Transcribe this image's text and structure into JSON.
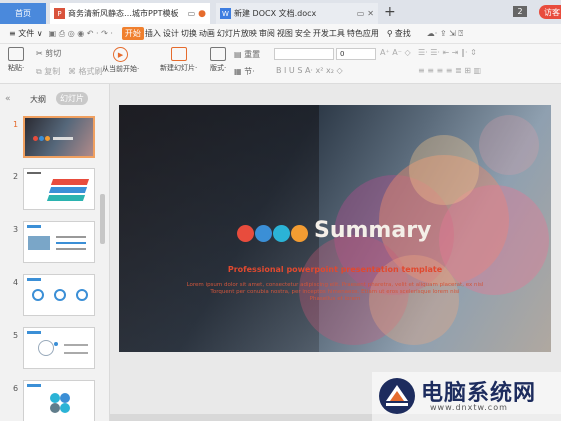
{
  "titlebar": {
    "home_tab": "首页",
    "ppt_tab": "商务清新风静态…城市PPT模板",
    "docx_tab": "新建 DOCX 文档.docx",
    "window_count": "2",
    "visitor": "访客",
    "plus": "+"
  },
  "menubar": {
    "file": "≡ 文件 ∨",
    "items": [
      "开始",
      "插入",
      "设计",
      "切换",
      "动画",
      "幻灯片放映",
      "审阅",
      "视图",
      "安全",
      "开发工具",
      "特色应用"
    ],
    "search": "查找"
  },
  "ribbon": {
    "paste": "粘贴·",
    "cut": "剪切",
    "copy": "复制",
    "format_painter": "格式刷",
    "from_current": "从当前开始·",
    "new_slide": "新建幻灯片·",
    "layout": "版式·",
    "section": "节·",
    "reset": "重置",
    "font_size": "0",
    "format_row": "B  I  U  S  A· x²  x₂  ◇"
  },
  "left_panel": {
    "collapse": "«",
    "outline_tab": "大纲",
    "slides_tab": "幻灯片",
    "slide_numbers": [
      "1",
      "2",
      "3",
      "4",
      "5",
      "6"
    ]
  },
  "slide": {
    "title": "Summary",
    "subtitle": "Professional powerpoint presentation template",
    "body_lines": [
      "Lorem ipsum dolor sit amet, consectetur adipiscing elit. Praesent pharetra, velit et aliquam placerat, ex nisl",
      "Torquent per conubia nostra, per inceptos himenaeos. Etiam ut eros scelerisque lorem nisi",
      "Phasellus et lorem"
    ]
  },
  "watermark": {
    "text": "电脑系统网",
    "url": "www.dnxtw.com"
  },
  "colors": {
    "accent_orange": "#f0802e",
    "home_tab_blue": "#4a89dc",
    "bubble_red": "#e84c3d",
    "bubble_blue": "#3b8fd6",
    "bubble_orange": "#f39c32"
  }
}
